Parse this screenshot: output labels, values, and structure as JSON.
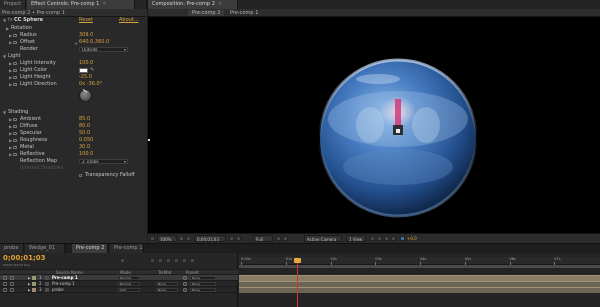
{
  "tabs_left": [
    {
      "label": "Project",
      "active": false
    },
    {
      "label": "Effect Controls: Pre-comp 1",
      "active": true
    }
  ],
  "tabs_comp": [
    {
      "label": "Composition: Pre-comp 2",
      "active": true
    }
  ],
  "effect_controls": {
    "breadcrumb": "Pre-comp 2 • Pre-comp 1",
    "effect_name": "CC Sphere",
    "reset_label": "Reset",
    "about_label": "About...",
    "rows": [
      {
        "label": "Rotation",
        "value": "",
        "indent": 1,
        "kind": "group"
      },
      {
        "label": "Radius",
        "value": "309.0",
        "indent": 2,
        "kind": "value"
      },
      {
        "label": "Offset",
        "value": "640.0,360.0",
        "indent": 2,
        "kind": "value"
      },
      {
        "label": "Render",
        "value": "Outside",
        "indent": 2,
        "kind": "dropdown"
      },
      {
        "label": "Light",
        "value": "",
        "indent": 0,
        "kind": "group"
      },
      {
        "label": "Light Intensity",
        "value": "100.0",
        "indent": 2,
        "kind": "value"
      },
      {
        "label": "Light Color",
        "value": "",
        "indent": 2,
        "kind": "color"
      },
      {
        "label": "Light Height",
        "value": "-25.0",
        "indent": 2,
        "kind": "value"
      },
      {
        "label": "Light Direction",
        "value": "0x -36.0°",
        "indent": 2,
        "kind": "value"
      },
      {
        "label": "",
        "value": "",
        "indent": 2,
        "kind": "dial"
      },
      {
        "label": "",
        "value": "",
        "indent": 2,
        "kind": "spacer"
      },
      {
        "label": "Shading",
        "value": "",
        "indent": 0,
        "kind": "group"
      },
      {
        "label": "Ambient",
        "value": "85.0",
        "indent": 2,
        "kind": "value"
      },
      {
        "label": "Diffuse",
        "value": "80.0",
        "indent": 2,
        "kind": "value"
      },
      {
        "label": "Specular",
        "value": "50.0",
        "indent": 2,
        "kind": "value"
      },
      {
        "label": "Roughness",
        "value": "0.050",
        "indent": 2,
        "kind": "value"
      },
      {
        "label": "Metal",
        "value": "30.0",
        "indent": 2,
        "kind": "value"
      },
      {
        "label": "Reflective",
        "value": "100.0",
        "indent": 2,
        "kind": "value"
      },
      {
        "label": "Reflection Map",
        "value": "2. probe",
        "indent": 2,
        "kind": "dropdown"
      },
      {
        "label": "Internal Shadows",
        "value": "",
        "indent": 2,
        "kind": "dim"
      },
      {
        "label": "",
        "value": "Transparency Falloff",
        "indent": 2,
        "kind": "checkbox"
      }
    ]
  },
  "composition": {
    "crumbs": [
      "Pre-comp 2",
      "Pre-comp 1"
    ],
    "footer": {
      "zoom": "100%",
      "timecode": "0;00;01;03",
      "resolution": "Full",
      "camera": "Active Camera",
      "views": "1 View",
      "exposure": "+0.0"
    }
  },
  "timeline": {
    "tabs": [
      {
        "label": "probe",
        "active": false
      },
      {
        "label": "Wedge_01",
        "active": false
      },
      {
        "label": "Pre-comp 2",
        "active": true
      },
      {
        "label": "Pre-comp 1",
        "active": false
      }
    ],
    "current_time": "0;00;01;03",
    "frames": "00033 (29.97 fps)",
    "columns": {
      "source_name": "Source Name",
      "mode": "Mode",
      "trkmat": "TrkMat",
      "parent": "Parent"
    },
    "layers": [
      {
        "num": "1",
        "name": "Pre-comp 1",
        "mode": "Normal",
        "trkmat": "",
        "parent": "None",
        "selected": true
      },
      {
        "num": "2",
        "name": "Pre-comp 1",
        "mode": "Normal",
        "trkmat": "None",
        "parent": "None",
        "selected": false
      },
      {
        "num": "3",
        "name": "probe",
        "mode": "Add",
        "trkmat": "None",
        "parent": "None",
        "selected": false
      }
    ],
    "ruler_ticks": [
      "0:00s",
      "01s",
      "02s",
      "03s",
      "04s",
      "05s",
      "06s",
      "07s"
    ]
  },
  "colors": {
    "accent": "#e2a12f",
    "playhead": "#d1372b",
    "layer_bar": "#8a7d64"
  }
}
